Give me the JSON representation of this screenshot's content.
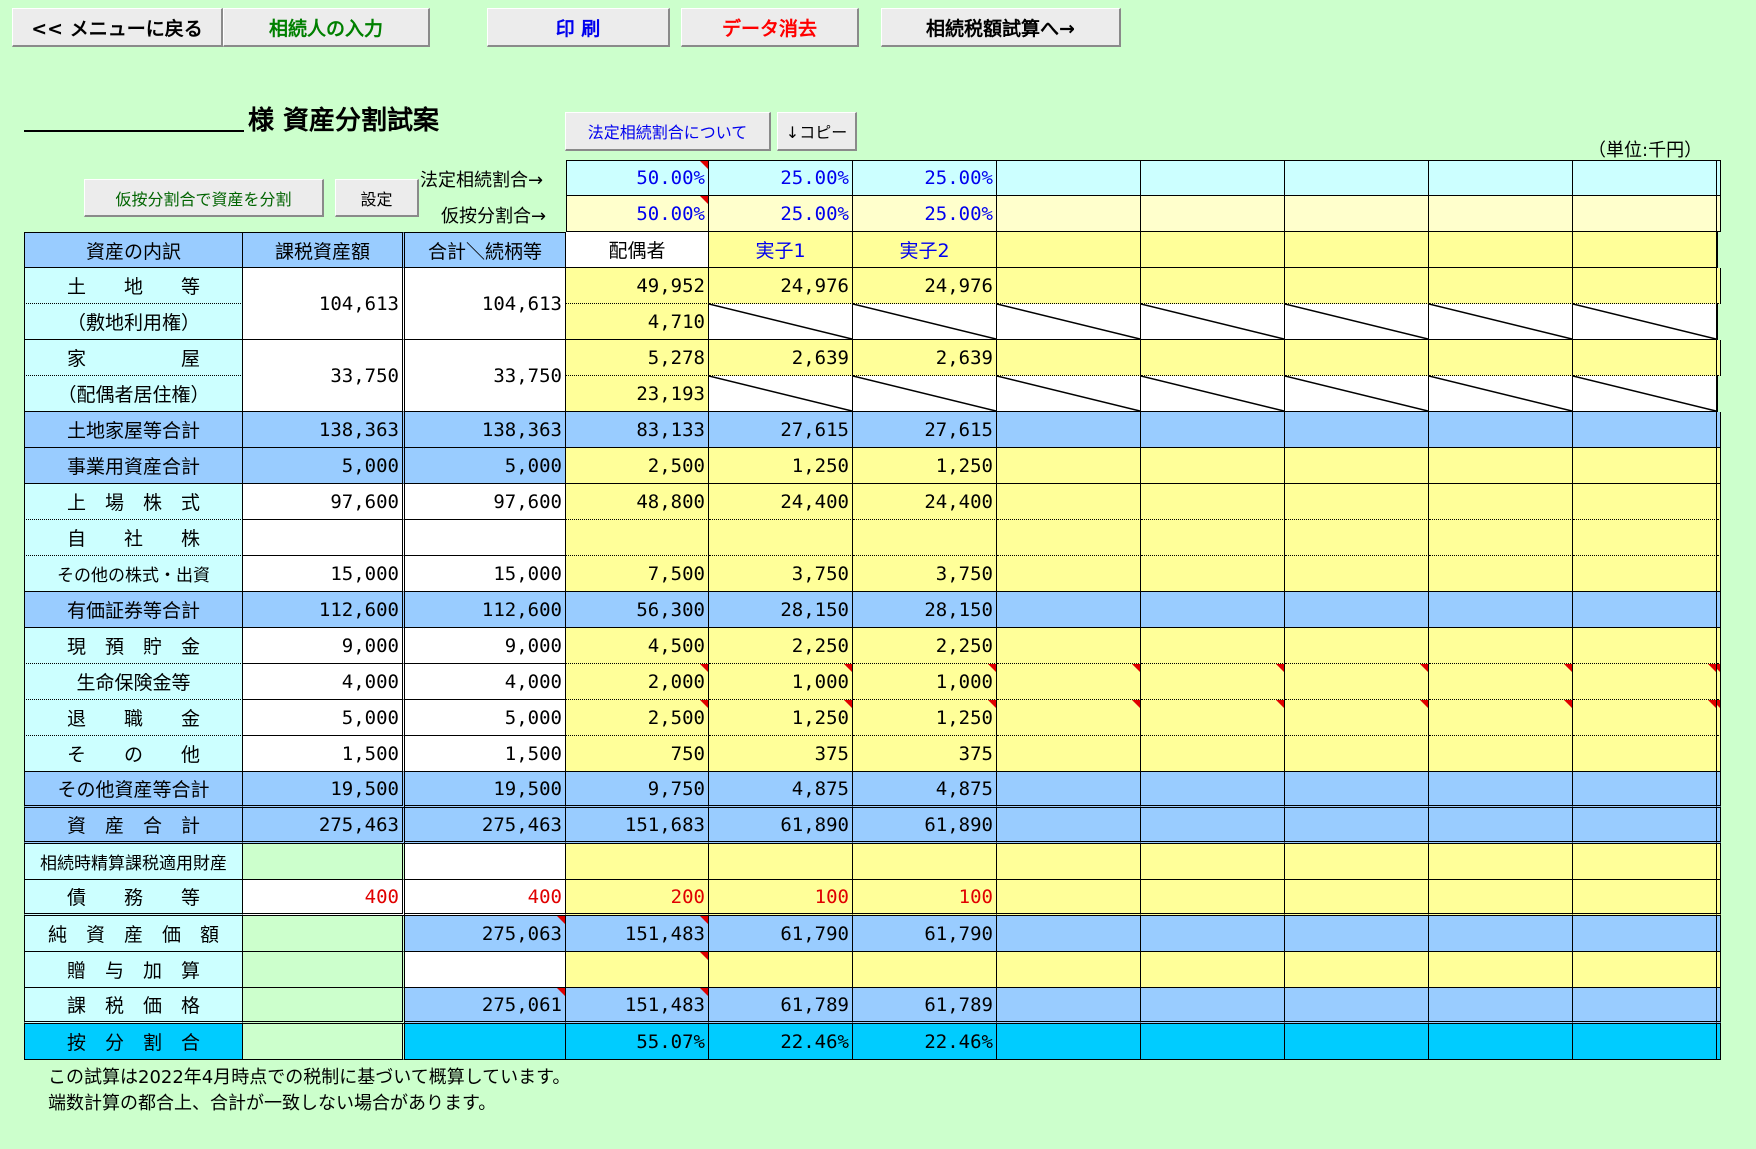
{
  "toolbar": {
    "back": "<< メニューに戻る",
    "heirs": "相続人の入力",
    "print": "印 刷",
    "clear": "データ消去",
    "tax_calc": "相続税額試算へ→"
  },
  "header": {
    "title": "様 資産分割試案",
    "legal_ratio_button": "法定相続割合について",
    "copy_button": "↓コピー",
    "unit": "（単位:千円）",
    "split_button": "仮按分割合で資産を分割",
    "setting_button": "設定",
    "legal_ratio_label": "法定相続割合→",
    "temp_ratio_label": "仮按分割合→"
  },
  "ratios": {
    "legal": [
      "50.00%",
      "25.00%",
      "25.00%",
      "",
      "",
      "",
      "",
      "",
      ""
    ],
    "temp": [
      "50.00%",
      "25.00%",
      "25.00%",
      "",
      "",
      "",
      "",
      "",
      ""
    ]
  },
  "table": {
    "col_headers": [
      "資産の内訳",
      "課税資産額",
      "合計＼続柄等"
    ],
    "heirs": [
      "配偶者",
      "実子1",
      "実子2",
      "",
      "",
      "",
      "",
      "",
      ""
    ],
    "rows": [
      {
        "label": "土　　地　　等",
        "taxable": "104,613",
        "total": "104,613",
        "v": [
          "49,952",
          "24,976",
          "24,976",
          "",
          "",
          "",
          "",
          "",
          ""
        ]
      },
      {
        "label": "（敷地利用権）",
        "v": [
          "4,710"
        ]
      },
      {
        "label": "家　　　　　屋",
        "taxable": "33,750",
        "total": "33,750",
        "v": [
          "5,278",
          "2,639",
          "2,639",
          "",
          "",
          "",
          "",
          "",
          ""
        ]
      },
      {
        "label": "（配偶者居住権）",
        "v": [
          "23,193"
        ]
      },
      {
        "label": "土地家屋等合計",
        "taxable": "138,363",
        "total": "138,363",
        "v": [
          "83,133",
          "27,615",
          "27,615",
          "",
          "",
          "",
          "",
          "",
          ""
        ]
      },
      {
        "label": "事業用資産合計",
        "taxable": "5,000",
        "total": "5,000",
        "v": [
          "2,500",
          "1,250",
          "1,250",
          "",
          "",
          "",
          "",
          "",
          ""
        ]
      },
      {
        "label": "上　場　株　式",
        "taxable": "97,600",
        "total": "97,600",
        "v": [
          "48,800",
          "24,400",
          "24,400",
          "",
          "",
          "",
          "",
          "",
          ""
        ]
      },
      {
        "label": "自　　社　　株",
        "taxable": "",
        "total": "",
        "v": [
          "",
          "",
          "",
          "",
          "",
          "",
          "",
          "",
          ""
        ]
      },
      {
        "label": "その他の株式・出資",
        "taxable": "15,000",
        "total": "15,000",
        "v": [
          "7,500",
          "3,750",
          "3,750",
          "",
          "",
          "",
          "",
          "",
          ""
        ]
      },
      {
        "label": "有価証券等合計",
        "taxable": "112,600",
        "total": "112,600",
        "v": [
          "56,300",
          "28,150",
          "28,150",
          "",
          "",
          "",
          "",
          "",
          ""
        ]
      },
      {
        "label": "現　預　貯　金",
        "taxable": "9,000",
        "total": "9,000",
        "v": [
          "4,500",
          "2,250",
          "2,250",
          "",
          "",
          "",
          "",
          "",
          ""
        ]
      },
      {
        "label": "生命保険金等",
        "taxable": "4,000",
        "total": "4,000",
        "v": [
          "2,000",
          "1,000",
          "1,000",
          "",
          "",
          "",
          "",
          "",
          ""
        ]
      },
      {
        "label": "退　　職　　金",
        "taxable": "5,000",
        "total": "5,000",
        "v": [
          "2,500",
          "1,250",
          "1,250",
          "",
          "",
          "",
          "",
          "",
          ""
        ]
      },
      {
        "label": "そ　　の　　他",
        "taxable": "1,500",
        "total": "1,500",
        "v": [
          "750",
          "375",
          "375",
          "",
          "",
          "",
          "",
          "",
          ""
        ]
      },
      {
        "label": "その他資産等合計",
        "taxable": "19,500",
        "total": "19,500",
        "v": [
          "9,750",
          "4,875",
          "4,875",
          "",
          "",
          "",
          "",
          "",
          ""
        ]
      },
      {
        "label": "資　産　合　計",
        "taxable": "275,463",
        "total": "275,463",
        "v": [
          "151,683",
          "61,890",
          "61,890",
          "",
          "",
          "",
          "",
          "",
          ""
        ]
      },
      {
        "label": "相続時精算課税適用財産",
        "taxable": "",
        "total": "",
        "v": [
          "",
          "",
          "",
          "",
          "",
          "",
          "",
          "",
          ""
        ]
      },
      {
        "label": "債　　務　　等",
        "taxable": "400",
        "total": "400",
        "v": [
          "200",
          "100",
          "100",
          "",
          "",
          "",
          "",
          "",
          ""
        ]
      },
      {
        "label": "純　資　産　価　額",
        "taxable": "",
        "total": "275,063",
        "v": [
          "151,483",
          "61,790",
          "61,790",
          "",
          "",
          "",
          "",
          "",
          ""
        ]
      },
      {
        "label": "贈　与　加　算",
        "taxable": "",
        "total": "",
        "v": [
          "",
          "",
          "",
          "",
          "",
          "",
          "",
          "",
          ""
        ]
      },
      {
        "label": "課　税　価　格",
        "taxable": "",
        "total": "275,061",
        "v": [
          "151,483",
          "61,789",
          "61,789",
          "",
          "",
          "",
          "",
          "",
          ""
        ]
      },
      {
        "label": "按　分　割　合",
        "taxable": "",
        "total": "",
        "v": [
          "55.07%",
          "22.46%",
          "22.46%",
          "",
          "",
          "",
          "",
          "",
          ""
        ]
      }
    ]
  },
  "notes": [
    "この試算は2022年4月時点での税制に基づいて概算しています。",
    "端数計算の都合上、合計が一致しない場合があります。"
  ],
  "colors": {
    "background": "#ccffcc",
    "label_blue": "#ccffff",
    "subtotal_blue": "#99ccff",
    "input_yellow": "#ffff99",
    "ratio_cyan": "#00ccff",
    "legal_ratio_bg": "#ccffff",
    "temp_ratio_bg": "#ffffcc",
    "debt_red": "#e00000",
    "heir_blue": "#0000ee"
  }
}
